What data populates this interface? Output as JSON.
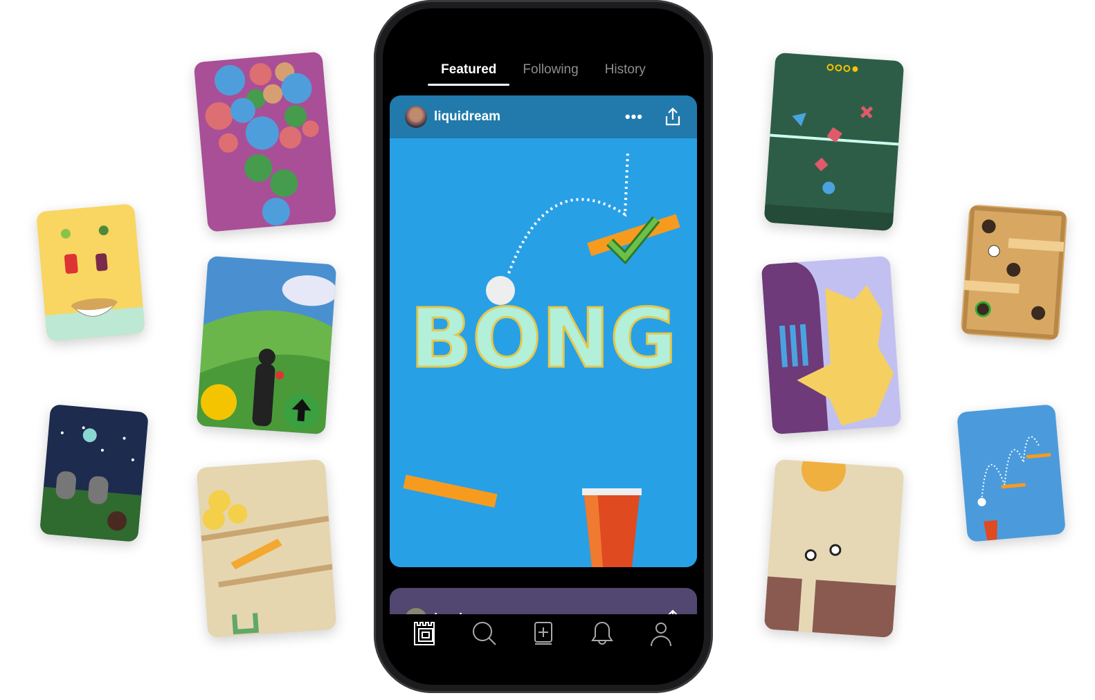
{
  "tabs": [
    {
      "label": "Featured",
      "active": true
    },
    {
      "label": "Following",
      "active": false
    },
    {
      "label": "History",
      "active": false
    }
  ],
  "posts": [
    {
      "username": "liquidream",
      "more_label": "•••",
      "color": "#217aab",
      "game_bg": "#28a0e6",
      "game_title": "BONG"
    },
    {
      "username": "brad",
      "more_label": "•••",
      "color": "#514770"
    }
  ],
  "nav": [
    {
      "icon": "home-icon"
    },
    {
      "icon": "search-icon"
    },
    {
      "icon": "create-icon"
    },
    {
      "icon": "bell-icon"
    },
    {
      "icon": "profile-icon"
    }
  ],
  "colors": {
    "accent": "#28a0e6",
    "mint": "#b2f0da",
    "orange": "#f79b1e"
  }
}
